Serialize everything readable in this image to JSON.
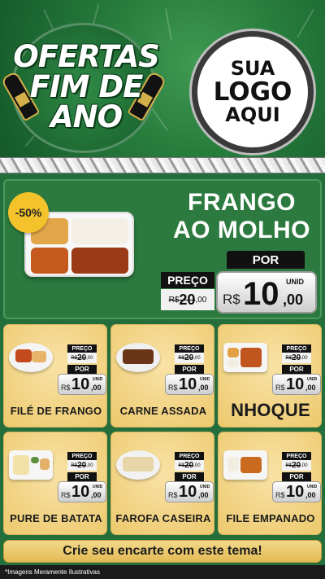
{
  "header": {
    "badge_lines": [
      "OFERTAS",
      "FIM DE",
      "ANO"
    ],
    "logo_lines": [
      "SUA",
      "LOGO",
      "AQUI"
    ]
  },
  "featured": {
    "discount": "-50%",
    "title_lines": [
      "FRANGO",
      "AO MOLHO"
    ],
    "por_label": "POR",
    "preco_label": "PREÇO",
    "old_price": {
      "currency": "R$",
      "integer": "20",
      "cents": ",00"
    },
    "new_price": {
      "currency": "R$",
      "integer": "10",
      "cents": ",00",
      "unit": "UNID"
    }
  },
  "price_labels": {
    "preco": "PREÇO",
    "por": "POR",
    "unit": "UNID",
    "currency": "R$"
  },
  "products": [
    {
      "name": "FILÉ DE FRANGO",
      "old_integer": "20",
      "old_cents": ",00",
      "new_integer": "10",
      "new_cents": ",00"
    },
    {
      "name": "CARNE ASSADA",
      "old_integer": "20",
      "old_cents": ",00",
      "new_integer": "10",
      "new_cents": ",00"
    },
    {
      "name": "NHOQUE",
      "old_integer": "20",
      "old_cents": ",00",
      "new_integer": "10",
      "new_cents": ",00"
    },
    {
      "name": "PURE DE BATATA",
      "old_integer": "20",
      "old_cents": ",00",
      "new_integer": "10",
      "new_cents": ",00"
    },
    {
      "name": "FAROFA CASEIRA",
      "old_integer": "20",
      "old_cents": ",00",
      "new_integer": "10",
      "new_cents": ",00"
    },
    {
      "name": "FILE EMPANADO",
      "old_integer": "20",
      "old_cents": ",00",
      "new_integer": "10",
      "new_cents": ",00"
    }
  ],
  "footer": {
    "cta": "Crie seu encarte com este tema!",
    "disclaimer": "*Imagens Meramente Ilustrativas"
  },
  "colors": {
    "header_green": "#267a3b",
    "card_gold": "#edc96d",
    "discount_yellow": "#f4c22a"
  }
}
